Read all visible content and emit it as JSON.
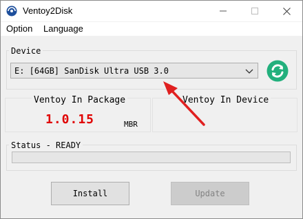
{
  "window": {
    "title": "Ventoy2Disk",
    "icon": "ventoy-logo-icon"
  },
  "menu": {
    "items": [
      "Option",
      "Language"
    ]
  },
  "device": {
    "group_label": "Device",
    "selected": "E: [64GB] SanDisk Ultra USB 3.0",
    "refresh_icon": "refresh-icon"
  },
  "package": {
    "label": "Ventoy In Package",
    "version": "1.0.15",
    "partition_style": "MBR"
  },
  "installed": {
    "label": "Ventoy In Device",
    "version": ""
  },
  "status": {
    "label": "Status - READY",
    "progress_percent": 0
  },
  "buttons": {
    "install": "Install",
    "update": "Update"
  },
  "colors": {
    "version_text": "#e00000",
    "refresh_green": "#22b07d",
    "annotation_arrow": "#e02020"
  }
}
